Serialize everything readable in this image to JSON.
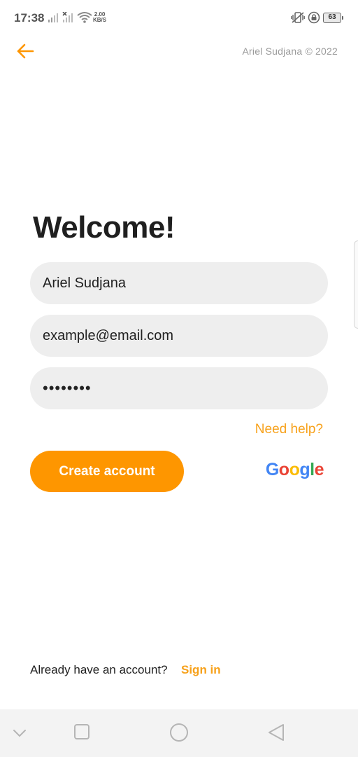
{
  "status_bar": {
    "time": "17:38",
    "net_speed_value": "2.00",
    "net_speed_unit": "KB/S",
    "battery_level": "63"
  },
  "header": {
    "copyright": "Ariel Sudjana © 2022"
  },
  "form": {
    "title": "Welcome!",
    "name_value": "Ariel Sudjana",
    "email_value": "example@email.com",
    "password_value": "••••••••",
    "need_help_label": "Need help?",
    "create_account_label": "Create account",
    "google_label": "Google"
  },
  "footer": {
    "already_text": "Already have an account?",
    "sign_in_label": "Sign in"
  },
  "colors": {
    "accent": "#fe9600",
    "link": "#f7a11a",
    "field_bg": "#eeeeee"
  }
}
